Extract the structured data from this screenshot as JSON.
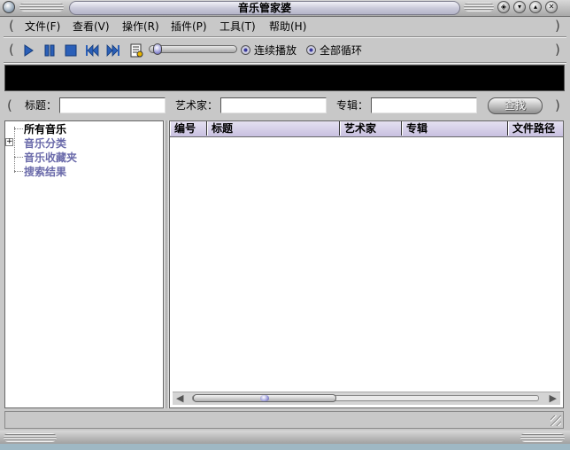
{
  "window": {
    "title": "音乐管家婆"
  },
  "menu": [
    {
      "label": "文件(F)"
    },
    {
      "label": "查看(V)"
    },
    {
      "label": "操作(R)"
    },
    {
      "label": "插件(P)"
    },
    {
      "label": "工具(T)"
    },
    {
      "label": "帮助(H)"
    }
  ],
  "toolbar": {
    "icons": [
      "play-icon",
      "pause-icon",
      "stop-icon",
      "previous-icon",
      "next-icon",
      "playlist-icon"
    ],
    "progress": 0.05,
    "continuous_play_label": "连续播放",
    "loop_all_label": "全部循环"
  },
  "search": {
    "title_label": "标题：",
    "title_value": "",
    "artist_label": "艺术家：",
    "artist_value": "",
    "album_label": "专辑：",
    "album_value": "",
    "search_button": "查找"
  },
  "tree": {
    "items": [
      {
        "label": "所有音乐",
        "selected": true
      },
      {
        "label": "音乐分类",
        "expandable": true
      },
      {
        "label": "音乐收藏夹"
      },
      {
        "label": "搜索结果"
      }
    ]
  },
  "list": {
    "columns": [
      "编号",
      "标题",
      "艺术家",
      "专辑",
      "文件路径"
    ],
    "rows": []
  },
  "status": {
    "text": ""
  },
  "colors": {
    "header_bg": "#c8c0e0",
    "tree_link": "#6a6aaa",
    "display_bg": "#000000"
  }
}
